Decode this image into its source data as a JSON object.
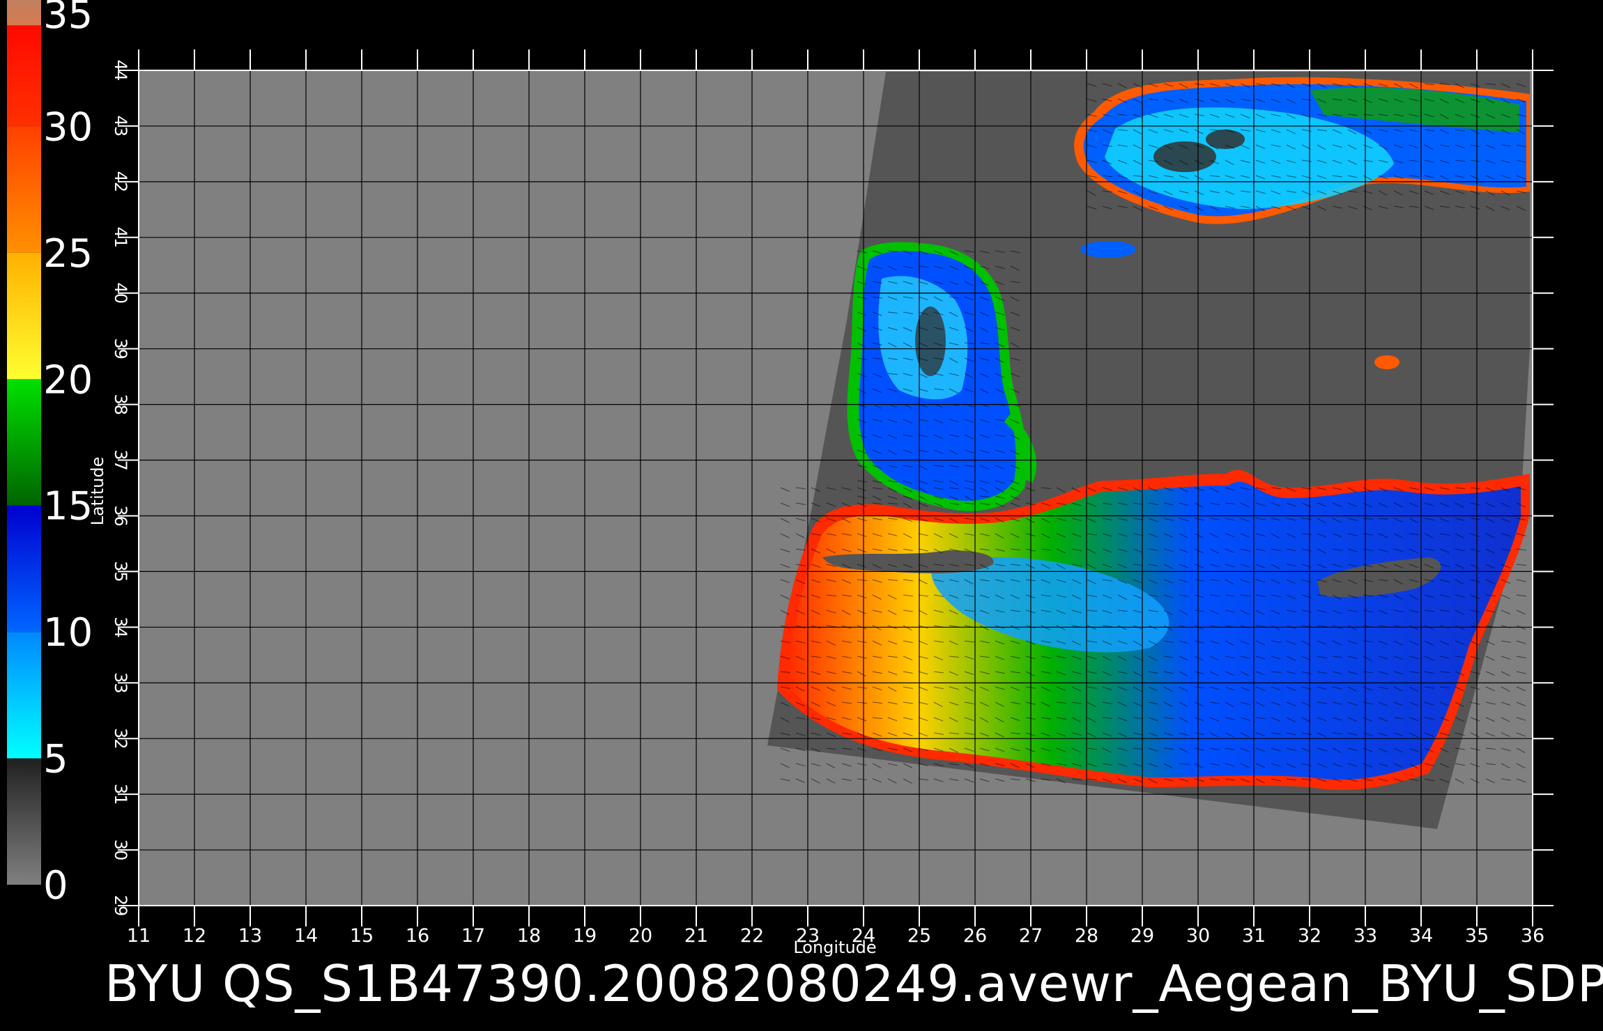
{
  "figure": {
    "caption": "BYU QS_S1B47390.20082080249.avewr_Aegean_BYU_SDP",
    "x_axis_title": "Longitude",
    "y_axis_title": "Latitude"
  },
  "colorbar": {
    "labels": [
      "35",
      "30",
      "25",
      "20",
      "15",
      "10",
      "5",
      "0"
    ],
    "range": [
      0,
      35
    ],
    "bands": [
      {
        "from": 0,
        "to": 5,
        "colors": [
          "#808080",
          "#202020"
        ]
      },
      {
        "from": 5,
        "to": 10,
        "colors": [
          "#00ffff",
          "#0088ff"
        ]
      },
      {
        "from": 10,
        "to": 15,
        "colors": [
          "#0066ff",
          "#0000d0"
        ]
      },
      {
        "from": 15,
        "to": 20,
        "colors": [
          "#006400",
          "#00e000"
        ]
      },
      {
        "from": 20,
        "to": 25,
        "colors": [
          "#ffff30",
          "#ffb000"
        ]
      },
      {
        "from": 25,
        "to": 30,
        "colors": [
          "#ff9000",
          "#ff4000"
        ]
      },
      {
        "from": 30,
        "to": 35,
        "colors": [
          "#ff3000",
          "#ff0000"
        ]
      },
      {
        "from": 34,
        "to": 35,
        "colors": [
          "#d87a50",
          "#c08060"
        ]
      }
    ]
  },
  "map": {
    "lon_range": [
      11,
      36
    ],
    "lat_range": [
      29,
      44
    ],
    "lon_ticks": [
      "11",
      "12",
      "13",
      "14",
      "15",
      "16",
      "17",
      "18",
      "19",
      "20",
      "21",
      "22",
      "23",
      "24",
      "25",
      "26",
      "27",
      "28",
      "29",
      "30",
      "31",
      "32",
      "33",
      "34",
      "35",
      "36"
    ],
    "lat_ticks": [
      "29",
      "30",
      "31",
      "32",
      "33",
      "34",
      "35",
      "36",
      "37",
      "38",
      "39",
      "40",
      "41",
      "42",
      "43",
      "44"
    ],
    "colors": {
      "background": "#000000",
      "nodata": "#808080",
      "swath_land": "#555555",
      "grid": "#000000",
      "frame": "#ffffff"
    }
  }
}
